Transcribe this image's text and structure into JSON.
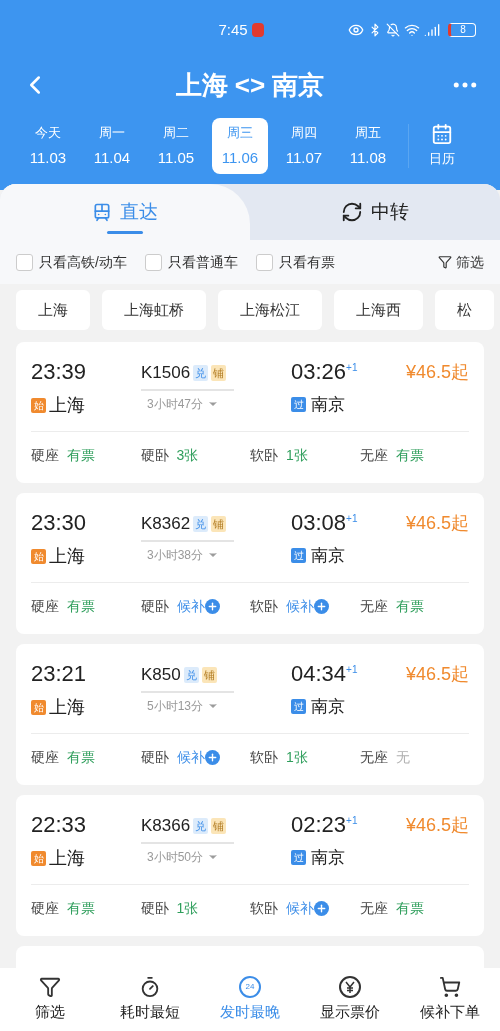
{
  "status_bar": {
    "time": "7:45",
    "battery": "8"
  },
  "header": {
    "title": "上海 <> 南京"
  },
  "dates": [
    {
      "weekday": "今天",
      "date": "11.03",
      "selected": false
    },
    {
      "weekday": "周一",
      "date": "11.04",
      "selected": false
    },
    {
      "weekday": "周二",
      "date": "11.05",
      "selected": false
    },
    {
      "weekday": "周三",
      "date": "11.06",
      "selected": true
    },
    {
      "weekday": "周四",
      "date": "11.07",
      "selected": false
    },
    {
      "weekday": "周五",
      "date": "11.08",
      "selected": false
    }
  ],
  "calendar_label": "日历",
  "tabs": [
    {
      "label": "直达",
      "selected": true
    },
    {
      "label": "中转",
      "selected": false
    }
  ],
  "filters": [
    {
      "label": "只看高铁/动车",
      "checked": false
    },
    {
      "label": "只看普通车",
      "checked": false
    },
    {
      "label": "只看有票",
      "checked": false
    }
  ],
  "filter_button": "筛选",
  "stations": [
    "上海",
    "上海虹桥",
    "上海松江",
    "上海西",
    "松"
  ],
  "trains": [
    {
      "depart": "23:39",
      "number": "K1506",
      "tags": [
        "兑",
        "铺"
      ],
      "arrive": "03:26",
      "day_offset": "+1",
      "duration": "3小时47分",
      "from_badge": "始",
      "from": "上海",
      "to_badge": "过",
      "to": "南京",
      "price": "¥46.5起",
      "seats": [
        {
          "name": "硬座",
          "status": "有票",
          "kind": "count"
        },
        {
          "name": "硬卧",
          "status": "3张",
          "kind": "count"
        },
        {
          "name": "软卧",
          "status": "1张",
          "kind": "count"
        },
        {
          "name": "无座",
          "status": "有票",
          "kind": "count"
        }
      ]
    },
    {
      "depart": "23:30",
      "number": "K8362",
      "tags": [
        "兑",
        "铺"
      ],
      "arrive": "03:08",
      "day_offset": "+1",
      "duration": "3小时38分",
      "from_badge": "始",
      "from": "上海",
      "to_badge": "过",
      "to": "南京",
      "price": "¥46.5起",
      "seats": [
        {
          "name": "硬座",
          "status": "有票",
          "kind": "count"
        },
        {
          "name": "硬卧",
          "status": "候补",
          "kind": "waitlist"
        },
        {
          "name": "软卧",
          "status": "候补",
          "kind": "waitlist"
        },
        {
          "name": "无座",
          "status": "有票",
          "kind": "count"
        }
      ]
    },
    {
      "depart": "23:21",
      "number": "K850",
      "tags": [
        "兑",
        "铺"
      ],
      "arrive": "04:34",
      "day_offset": "+1",
      "duration": "5小时13分",
      "from_badge": "始",
      "from": "上海",
      "to_badge": "过",
      "to": "南京",
      "price": "¥46.5起",
      "seats": [
        {
          "name": "硬座",
          "status": "有票",
          "kind": "count"
        },
        {
          "name": "硬卧",
          "status": "候补",
          "kind": "waitlist"
        },
        {
          "name": "软卧",
          "status": "1张",
          "kind": "count"
        },
        {
          "name": "无座",
          "status": "无",
          "kind": "none"
        }
      ]
    },
    {
      "depart": "22:33",
      "number": "K8366",
      "tags": [
        "兑",
        "铺"
      ],
      "arrive": "02:23",
      "day_offset": "+1",
      "duration": "3小时50分",
      "from_badge": "始",
      "from": "上海",
      "to_badge": "过",
      "to": "南京",
      "price": "¥46.5起",
      "seats": [
        {
          "name": "硬座",
          "status": "有票",
          "kind": "count"
        },
        {
          "name": "硬卧",
          "status": "1张",
          "kind": "count"
        },
        {
          "name": "软卧",
          "status": "候补",
          "kind": "waitlist"
        },
        {
          "name": "无座",
          "status": "有票",
          "kind": "count"
        }
      ]
    }
  ],
  "bottom_nav": [
    {
      "label": "筛选",
      "kind": "filter",
      "selected": false
    },
    {
      "label": "耗时最短",
      "kind": "timer",
      "selected": false
    },
    {
      "label": "发时最晚",
      "kind": "clock",
      "badge": "24",
      "selected": true
    },
    {
      "label": "显示票价",
      "kind": "price",
      "selected": false
    },
    {
      "label": "候补下单",
      "kind": "cart",
      "selected": false
    }
  ]
}
